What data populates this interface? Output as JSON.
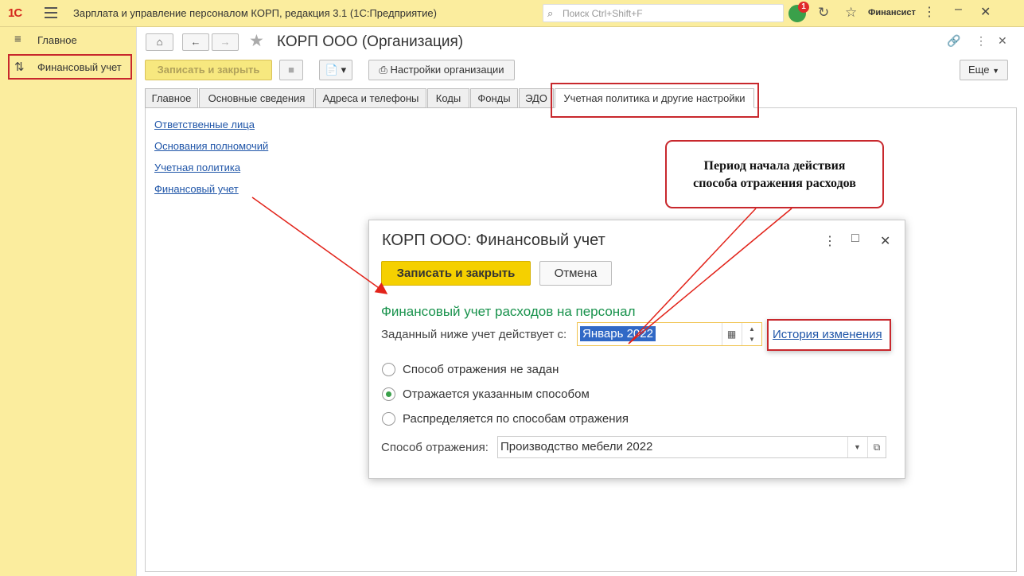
{
  "titlebar": {
    "logo": "1С",
    "app_title": "Зарплата и управление персоналом КОРП, редакция 3.1  (1С:Предприятие)",
    "search_placeholder": "Поиск Ctrl+Shift+F",
    "notification_count": "1",
    "user": "Финансист"
  },
  "sidebar": {
    "items": [
      {
        "label": "Главное",
        "icon": "menu-icon"
      },
      {
        "label": "Финансовый учет",
        "icon": "finance-icon"
      }
    ]
  },
  "form": {
    "title": "КОРП ООО (Организация)",
    "save_close": "Записать и закрыть",
    "org_settings": "Настройки организации",
    "more": "Еще"
  },
  "tabs": [
    {
      "label": "Главное"
    },
    {
      "label": "Основные сведения"
    },
    {
      "label": "Адреса и телефоны"
    },
    {
      "label": "Коды"
    },
    {
      "label": "Фонды"
    },
    {
      "label": "ЭДО"
    },
    {
      "label": "Учетная политика и другие настройки"
    }
  ],
  "links": [
    "Ответственные лица",
    "Основания полномочий",
    "Учетная политика",
    "Финансовый учет"
  ],
  "callout": {
    "line1": "Период начала действия",
    "line2": "способа отражения расходов"
  },
  "dialog": {
    "title": "КОРП ООО: Финансовый учет",
    "save_close": "Записать и закрыть",
    "cancel": "Отмена",
    "section": "Финансовый учет расходов на персонал",
    "period_label": "Заданный ниже учет действует с:",
    "period_value": "Январь 2022",
    "history_link": "История изменения",
    "radios": [
      {
        "label": "Способ отражения не задан",
        "selected": false
      },
      {
        "label": "Отражается указанным способом",
        "selected": true
      },
      {
        "label": "Распределяется по способам отражения",
        "selected": false
      }
    ],
    "method_label": "Способ отражения:",
    "method_value": "Производство мебели 2022"
  },
  "colors": {
    "accent_yellow": "#fbed9e",
    "highlight_red": "#c8282d",
    "section_green": "#18924c",
    "link_blue": "#1f55a8"
  }
}
